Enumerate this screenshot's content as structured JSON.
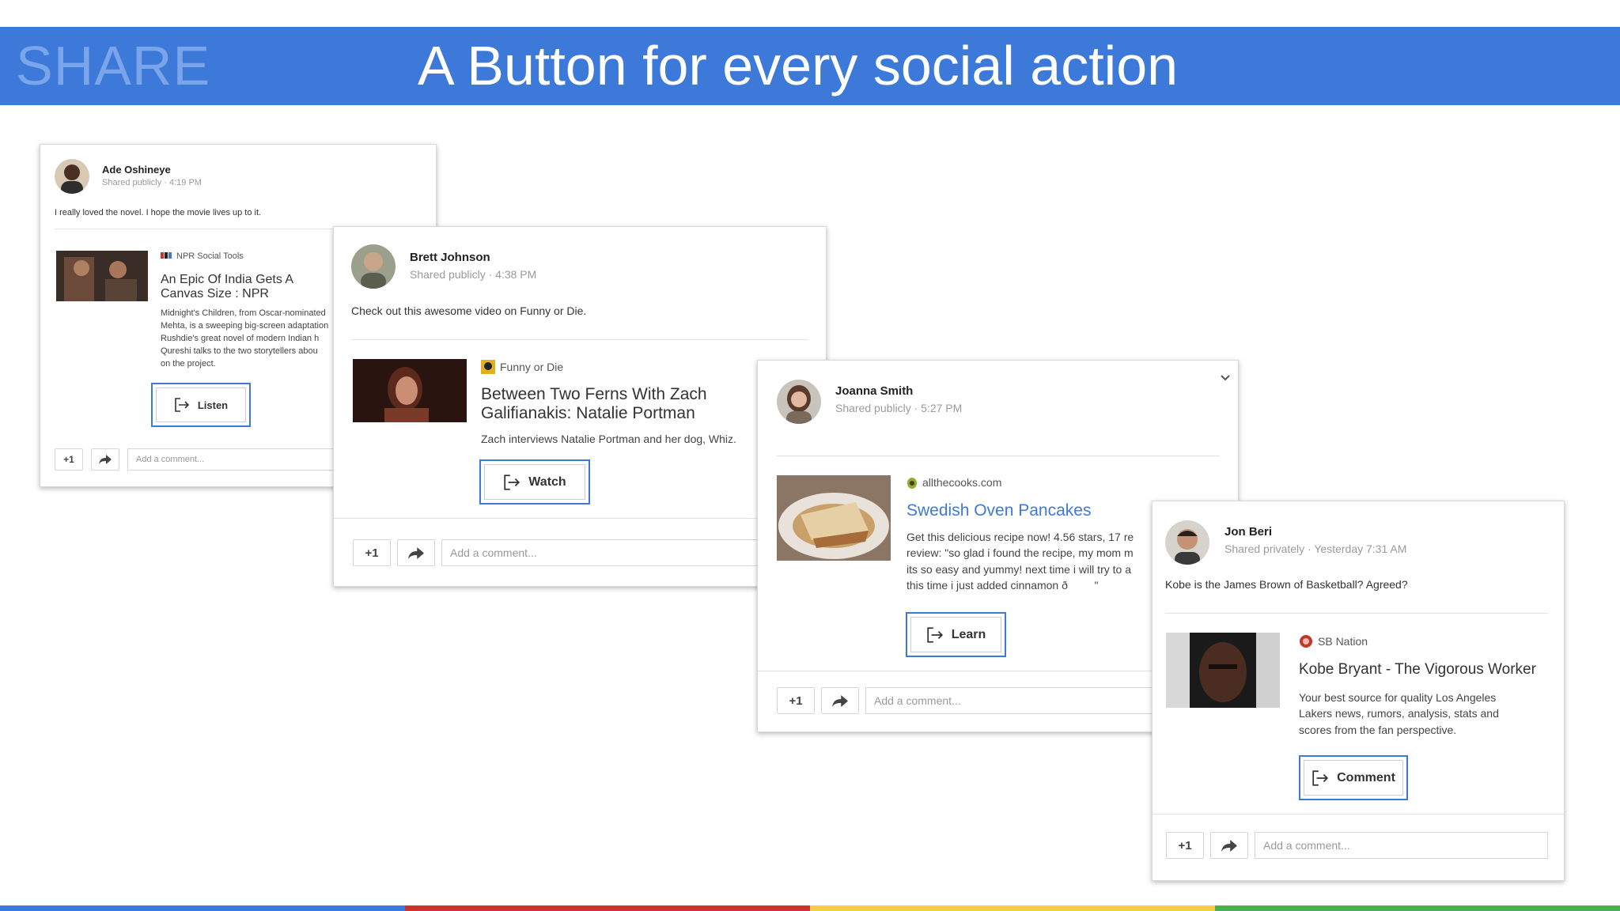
{
  "banner": {
    "tag": "SHARE",
    "headline": "A Button for every social action",
    "background": "#3d79d8"
  },
  "cards": [
    {
      "author": "Ade Oshineye",
      "meta": "Shared publicly  ·  4:19 PM",
      "post": "I really loved the novel. I hope the movie lives up to it.",
      "source": "NPR Social Tools",
      "title": "An Epic Of India Gets A Canvas Size : NPR",
      "desc": [
        "Midnight's Children, from Oscar-nominated",
        "Mehta, is a sweeping big-screen adaptation",
        "Rushdie's great novel of modern Indian h",
        "Qureshi talks to the two storytellers abou",
        "on the project."
      ],
      "action": "Listen",
      "plus": "+1",
      "comment_placeholder": "Add a comment..."
    },
    {
      "author": "Brett Johnson",
      "meta": "Shared publicly  ·  4:38 PM",
      "post": "Check out this awesome video on Funny or Die.",
      "source": "Funny or Die",
      "title": "Between Two Ferns With Zach Galifianakis: Natalie Portman",
      "desc": [
        "Zach interviews Natalie Portman and her dog, Whiz."
      ],
      "action": "Watch",
      "plus": "+1",
      "comment_placeholder": "Add a comment..."
    },
    {
      "author": "Joanna Smith",
      "meta": "Shared publicly  ·  5:27 PM",
      "source": "allthecooks.com",
      "title": "Swedish Oven Pancakes",
      "desc": [
        "Get this delicious recipe now! 4.56 stars, 17 re",
        "review: \"so glad i found the recipe, my mom m",
        "its so easy and yummy! next time i will try to a",
        "this time i just added cinnamon ð\""
      ],
      "action": "Learn",
      "plus": "+1",
      "comment_placeholder": "Add a comment..."
    },
    {
      "author": "Jon Beri",
      "meta": "Shared privately  ·  Yesterday 7:31 AM",
      "post": "Kobe is the James Brown of Basketball? Agreed?",
      "source": "SB Nation",
      "title": "Kobe Bryant - The Vigorous Worker",
      "desc": [
        "Your best source for quality Los Angeles",
        "Lakers news, rumors, analysis, stats and",
        "scores from the fan perspective."
      ],
      "action": "Comment",
      "plus": "+1",
      "comment_placeholder": "Add a comment..."
    }
  ],
  "bottom_bar_colors": [
    "#3d79d8",
    "#d32f2f",
    "#f4d03f",
    "#4caf50"
  ],
  "link_color": "#3d79d8"
}
